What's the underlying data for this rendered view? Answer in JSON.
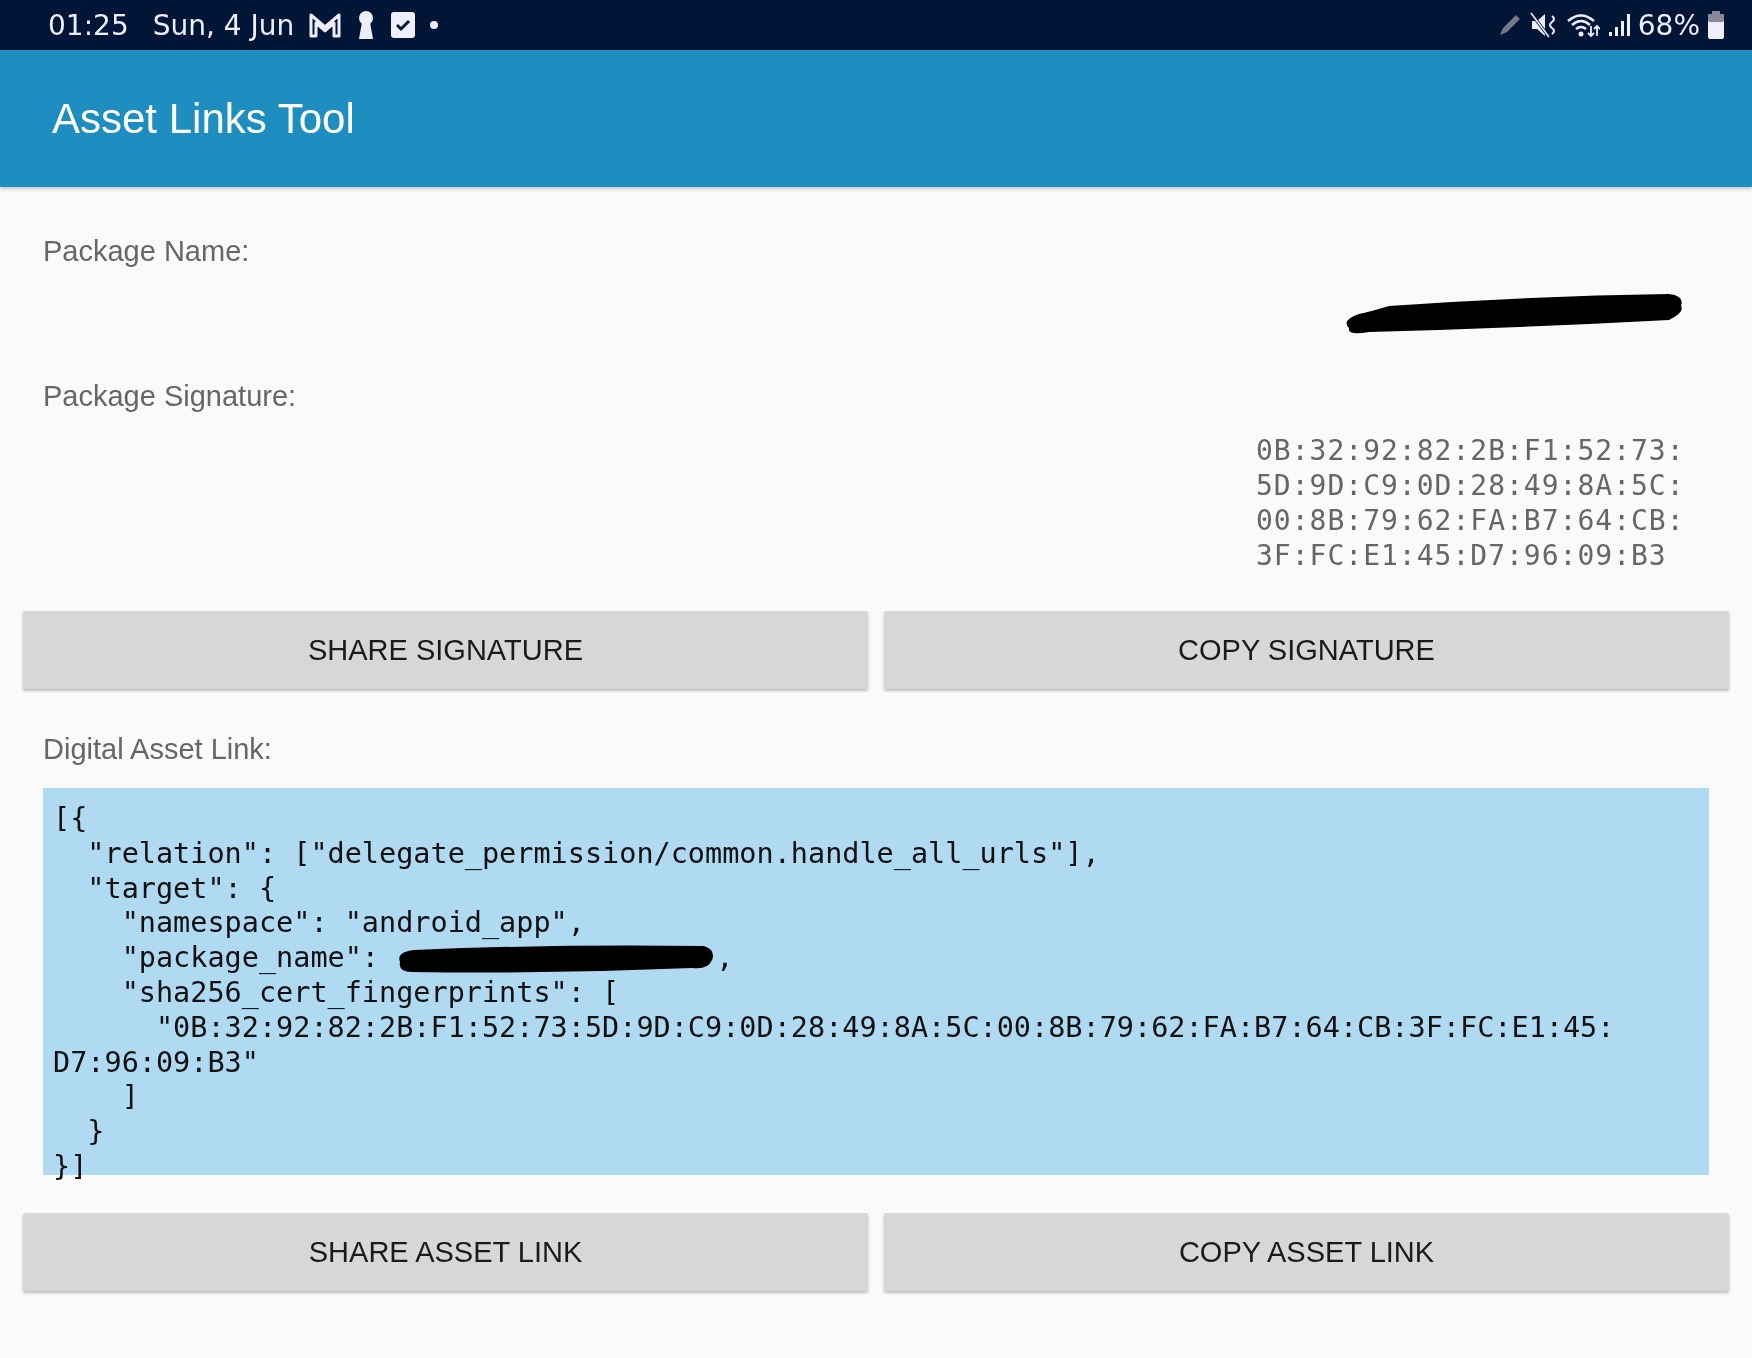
{
  "status_bar": {
    "time": "01:25",
    "date": "Sun, 4 Jun",
    "battery": "68%"
  },
  "app_bar": {
    "title": "Asset Links Tool"
  },
  "package_name": {
    "label": "Package Name:",
    "value_redacted": true
  },
  "package_signature": {
    "label": "Package Signature:",
    "lines": [
      "0B:32:92:82:2B:F1:52:73:",
      "5D:9D:C9:0D:28:49:8A:5C:",
      "00:8B:79:62:FA:B7:64:CB:",
      "3F:FC:E1:45:D7:96:09:B3"
    ]
  },
  "signature_buttons": [
    "SHARE SIGNATURE",
    "COPY SIGNATURE"
  ],
  "digital_asset_link": {
    "label": "Digital Asset Link:",
    "lines": [
      {
        "kind": "text",
        "text": "[{"
      },
      {
        "kind": "text",
        "text": "  \"relation\": [\"delegate_permission/common.handle_all_urls\"],"
      },
      {
        "kind": "text",
        "text": "  \"target\": {"
      },
      {
        "kind": "text",
        "text": "    \"namespace\": \"android_app\","
      },
      {
        "kind": "redacted",
        "text": "    \"package_name\": ",
        "after": ","
      },
      {
        "kind": "text",
        "text": "    \"sha256_cert_fingerprints\": ["
      },
      {
        "kind": "text",
        "text": "      \"0B:32:92:82:2B:F1:52:73:5D:9D:C9:0D:28:49:8A:5C:00:8B:79:62:FA:B7:64:CB:3F:FC:E1:45:"
      },
      {
        "kind": "text",
        "text": "D7:96:09:B3\""
      },
      {
        "kind": "text",
        "text": "    ]"
      },
      {
        "kind": "text",
        "text": "  }"
      },
      {
        "kind": "text",
        "text": "}]"
      }
    ]
  },
  "asset_link_buttons": [
    "SHARE ASSET LINK",
    "COPY ASSET LINK"
  ]
}
